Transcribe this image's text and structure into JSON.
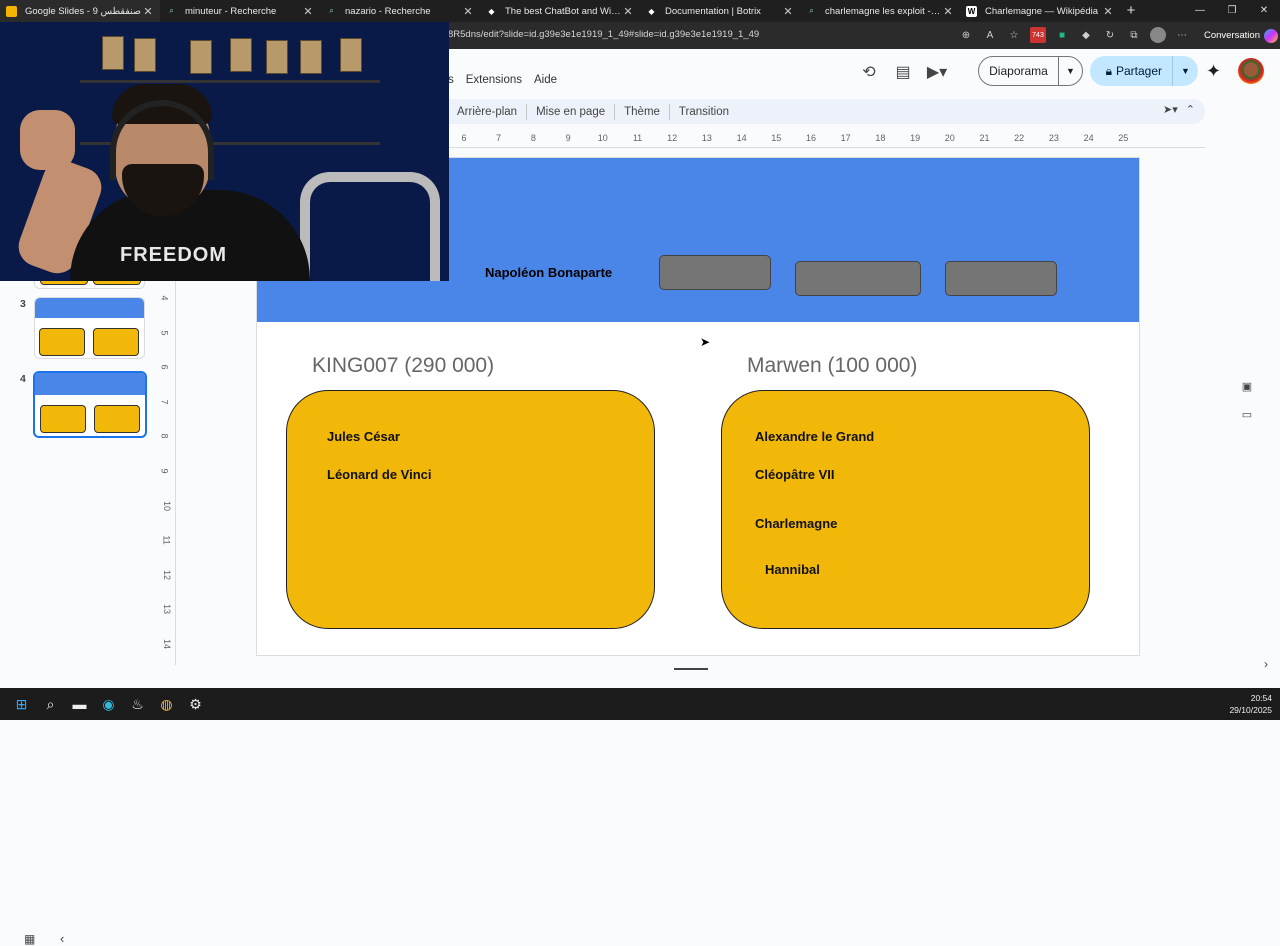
{
  "browser": {
    "tabs": [
      {
        "title": "Google Slides - صنفقطس 9",
        "icon": "slides-icon",
        "active": true
      },
      {
        "title": "minuteur - Recherche",
        "icon": "search-icon"
      },
      {
        "title": "nazario - Recherche",
        "icon": "search-icon"
      },
      {
        "title": "The best ChatBot and Widgets fo",
        "icon": "botrix-icon"
      },
      {
        "title": "Documentation | Botrix",
        "icon": "botrix-icon"
      },
      {
        "title": "charlemagne les exploit - Recherc",
        "icon": "search-icon"
      },
      {
        "title": "Charlemagne — Wikipédia",
        "icon": "wikipedia-icon"
      }
    ],
    "url": "8R5dns/edit?slide=id.g39e3e1e1919_1_49#slide=id.g39e3e1e1919_1_49",
    "extension_badge": "743",
    "conversation_label": "Conversation"
  },
  "menu": [
    "s",
    "Extensions",
    "Aide"
  ],
  "header": {
    "diaporama_label": "Diaporama",
    "partager_label": "Partager"
  },
  "toolbar": [
    "Arrière-plan",
    "Mise en page",
    "Thème",
    "Transition"
  ],
  "ruler": {
    "h": [
      "6",
      "7",
      "8",
      "9",
      "10",
      "11",
      "12",
      "13",
      "14",
      "15",
      "16",
      "17",
      "18",
      "19",
      "20",
      "21",
      "22",
      "23",
      "24",
      "25"
    ],
    "v": [
      "4",
      "5",
      "6",
      "7",
      "8",
      "9",
      "10",
      "11",
      "12",
      "13",
      "14"
    ]
  },
  "filmstrip": [
    {
      "number": "3"
    },
    {
      "number": "4",
      "selected": true
    }
  ],
  "slide": {
    "banner_text": "Napoléon Bonaparte",
    "colors": {
      "banner": "#4a86e8",
      "card": "#f1b80a",
      "box": "#757575"
    },
    "players": [
      {
        "name": "KING007 (290 000)",
        "items": [
          "Jules César",
          "Léonard de Vinci"
        ]
      },
      {
        "name": "Marwen (100 000)",
        "items": [
          "Alexandre le Grand",
          "Cléopâtre VII",
          "Charlemagne",
          "Hannibal"
        ]
      }
    ]
  },
  "webcam": {
    "shirt_text": "FREEDOM"
  },
  "taskbar": {
    "time": "20:54",
    "date": "29/10/2025"
  }
}
